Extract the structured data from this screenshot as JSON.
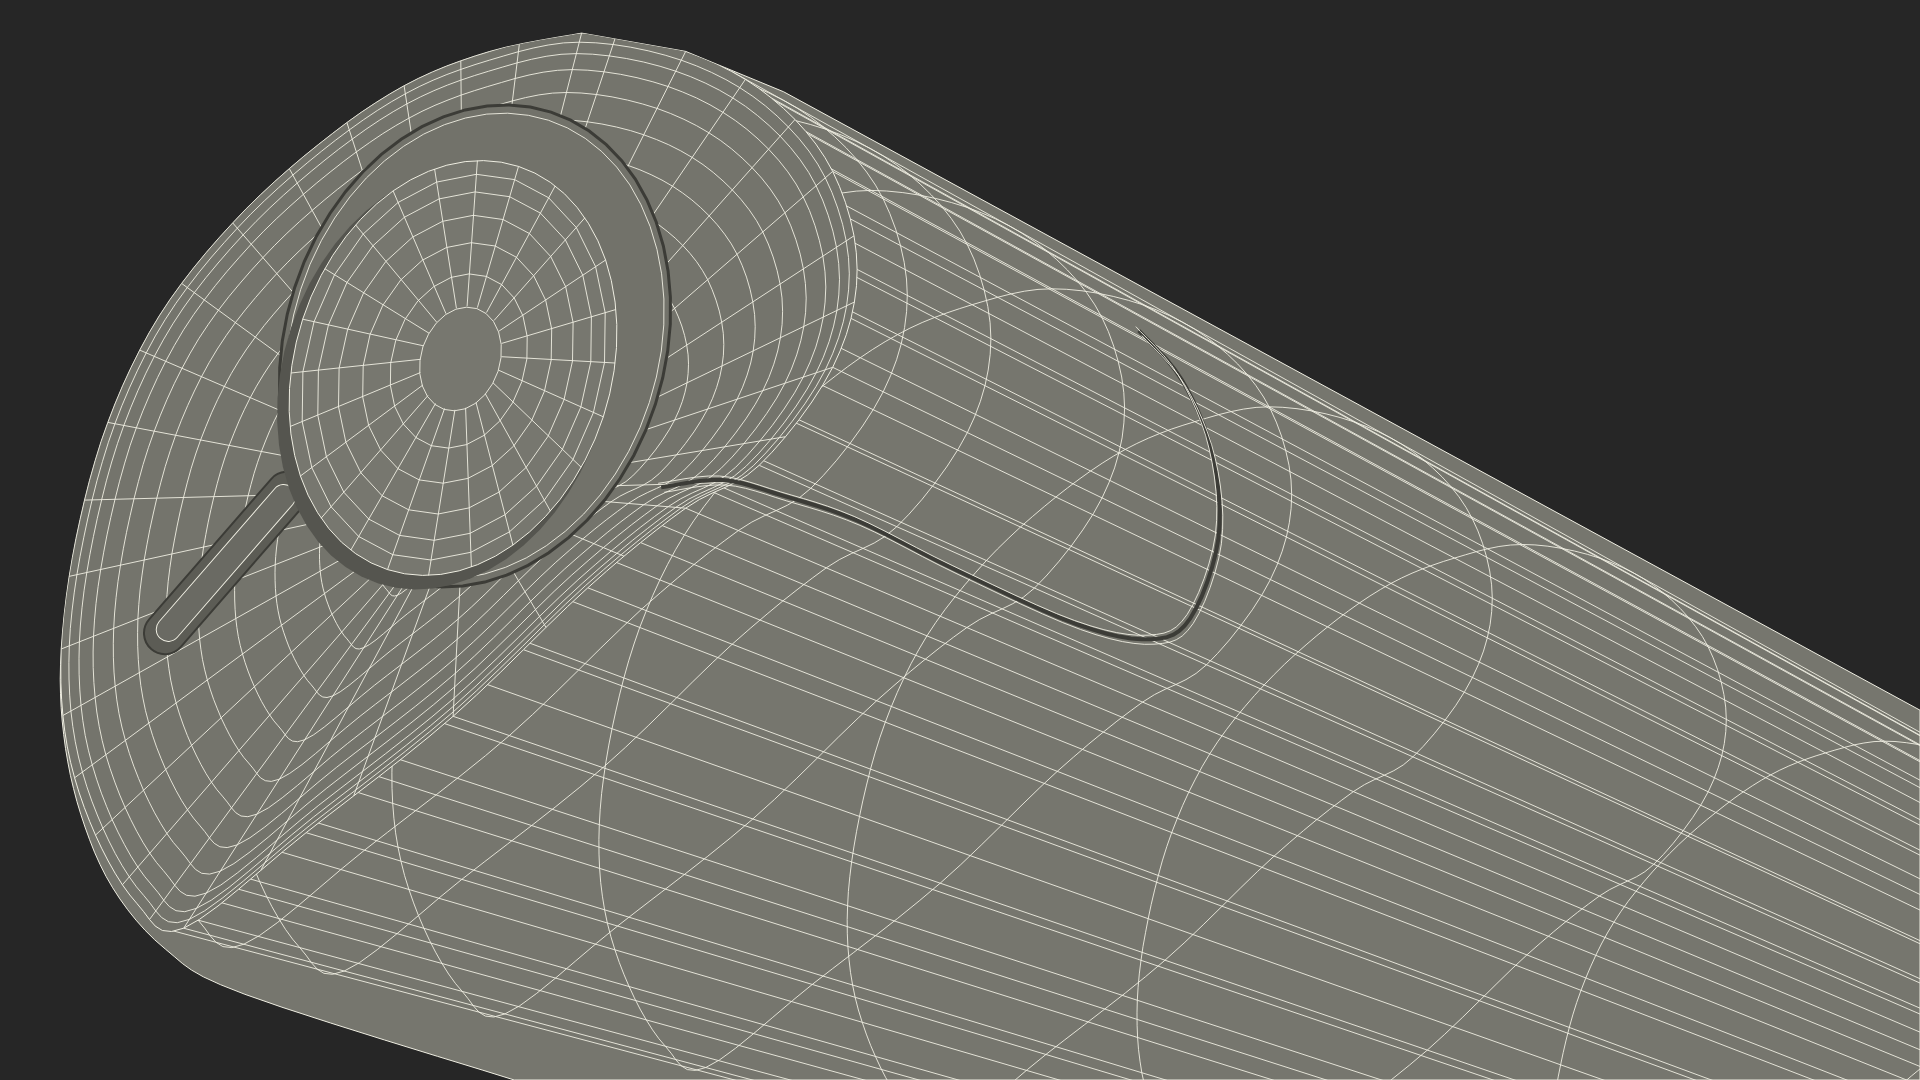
{
  "viewport": {
    "wireframe": true
  }
}
